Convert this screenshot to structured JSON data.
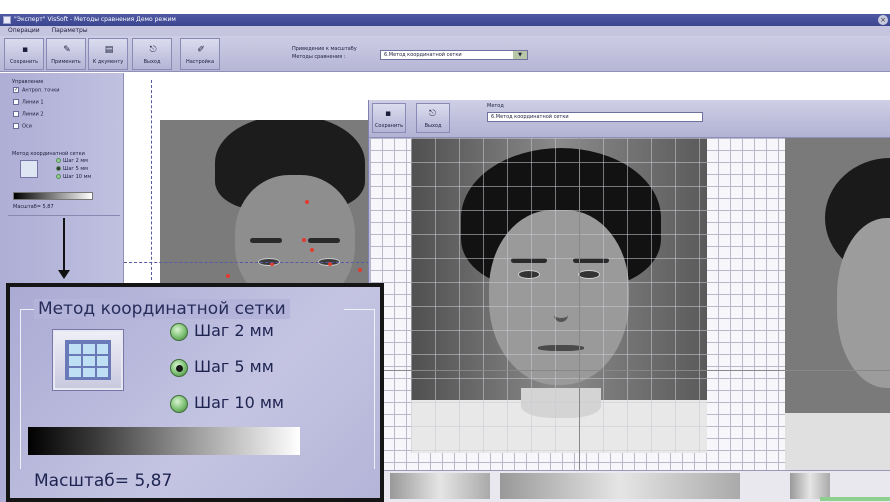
{
  "window": {
    "title": "\"Эксперт\" VisSoft - Методы сравнения Демо режим"
  },
  "menu": {
    "items": [
      "Операции",
      "Параметры"
    ]
  },
  "toolbar": {
    "buttons": [
      {
        "label": "Сохранить",
        "icon": "floppy-icon"
      },
      {
        "label": "Применить",
        "icon": "apply-icon"
      },
      {
        "label": "К дкументу",
        "icon": "document-icon"
      },
      {
        "label": "Выход",
        "icon": "exit-icon"
      },
      {
        "label": "Настройка",
        "icon": "settings-icon"
      }
    ],
    "compare_label_1": "Приведение к масштабу",
    "compare_label_2": "Методы сравнения :",
    "method_value": "6.Метод координатной сетки"
  },
  "left_panel": {
    "group_title": "Управление",
    "checks": [
      {
        "label": "Антроп. точки",
        "checked": true
      },
      {
        "label": "Линии 1",
        "checked": false
      },
      {
        "label": "Линии 2",
        "checked": false
      },
      {
        "label": "Оси",
        "checked": false
      }
    ],
    "grid_method_title": "Метод координатной сетки",
    "steps": [
      "Шаг 2 мм",
      "Шаг 5 мм",
      "Шаг 10 мм"
    ],
    "selected_step": 1,
    "scale_text": "Масштаб= 5,87"
  },
  "compare_window": {
    "buttons": [
      {
        "label": "Сохранить",
        "icon": "floppy-icon"
      },
      {
        "label": "Выход",
        "icon": "exit-icon"
      }
    ],
    "method_label": "Метод",
    "method_value": "6.Метод координатной сетки"
  },
  "zoom": {
    "title": "Метод координатной сетки",
    "steps": [
      "Шаг 2 мм",
      "Шаг 5 мм",
      "Шаг 10 мм"
    ],
    "selected_step": 1,
    "scale_text": "Масштаб= 5,87"
  },
  "colors": {
    "panel": "#b4b4d8",
    "title_bar": "#3b4590",
    "radio_green": "#7cc072"
  }
}
